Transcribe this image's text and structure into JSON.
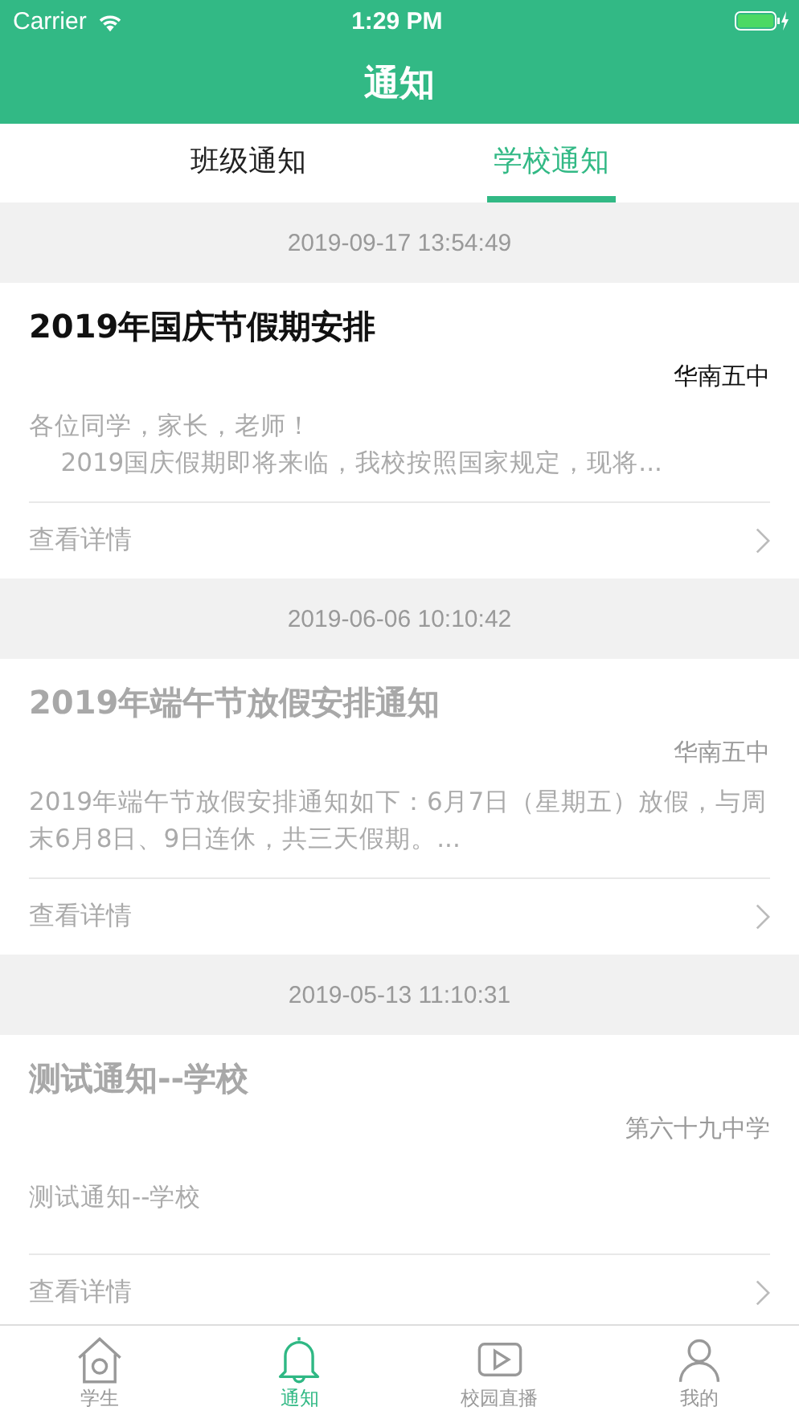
{
  "status_bar": {
    "carrier": "Carrier",
    "time": "1:29 PM"
  },
  "nav_bar": {
    "title": "通知"
  },
  "tabs": [
    {
      "label": "班级通知",
      "selected": false
    },
    {
      "label": "学校通知",
      "selected": true
    }
  ],
  "notices": [
    {
      "date": "2019-09-17 13:54:49",
      "title": "2019年国庆节假期安排",
      "read": false,
      "source": "华南五中",
      "body_lines": [
        "各位同学，家长，老师！",
        "    2019国庆假期即将来临，我校按照国家规定，现将..."
      ],
      "link": "查看详情"
    },
    {
      "date": "2019-06-06 10:10:42",
      "title": "2019年端午节放假安排通知",
      "read": true,
      "source": "华南五中",
      "body_lines": [
        "2019年端午节放假安排通知如下：6月7日（星期五）放假，与周末6月8日、9日连休，共三天假期。..."
      ],
      "link": "查看详情"
    },
    {
      "date": "2019-05-13 11:10:31",
      "title": "测试通知--学校",
      "read": true,
      "source": "第六十九中学",
      "body_lines": [
        "测试通知--学校"
      ],
      "link": "查看详情"
    }
  ],
  "tab_bar": [
    {
      "label": "学生",
      "kind": "house",
      "selected": false
    },
    {
      "label": "通知",
      "kind": "bell",
      "selected": true
    },
    {
      "label": "校园直播",
      "kind": "play",
      "selected": false
    },
    {
      "label": "我的",
      "kind": "person",
      "selected": false
    }
  ]
}
